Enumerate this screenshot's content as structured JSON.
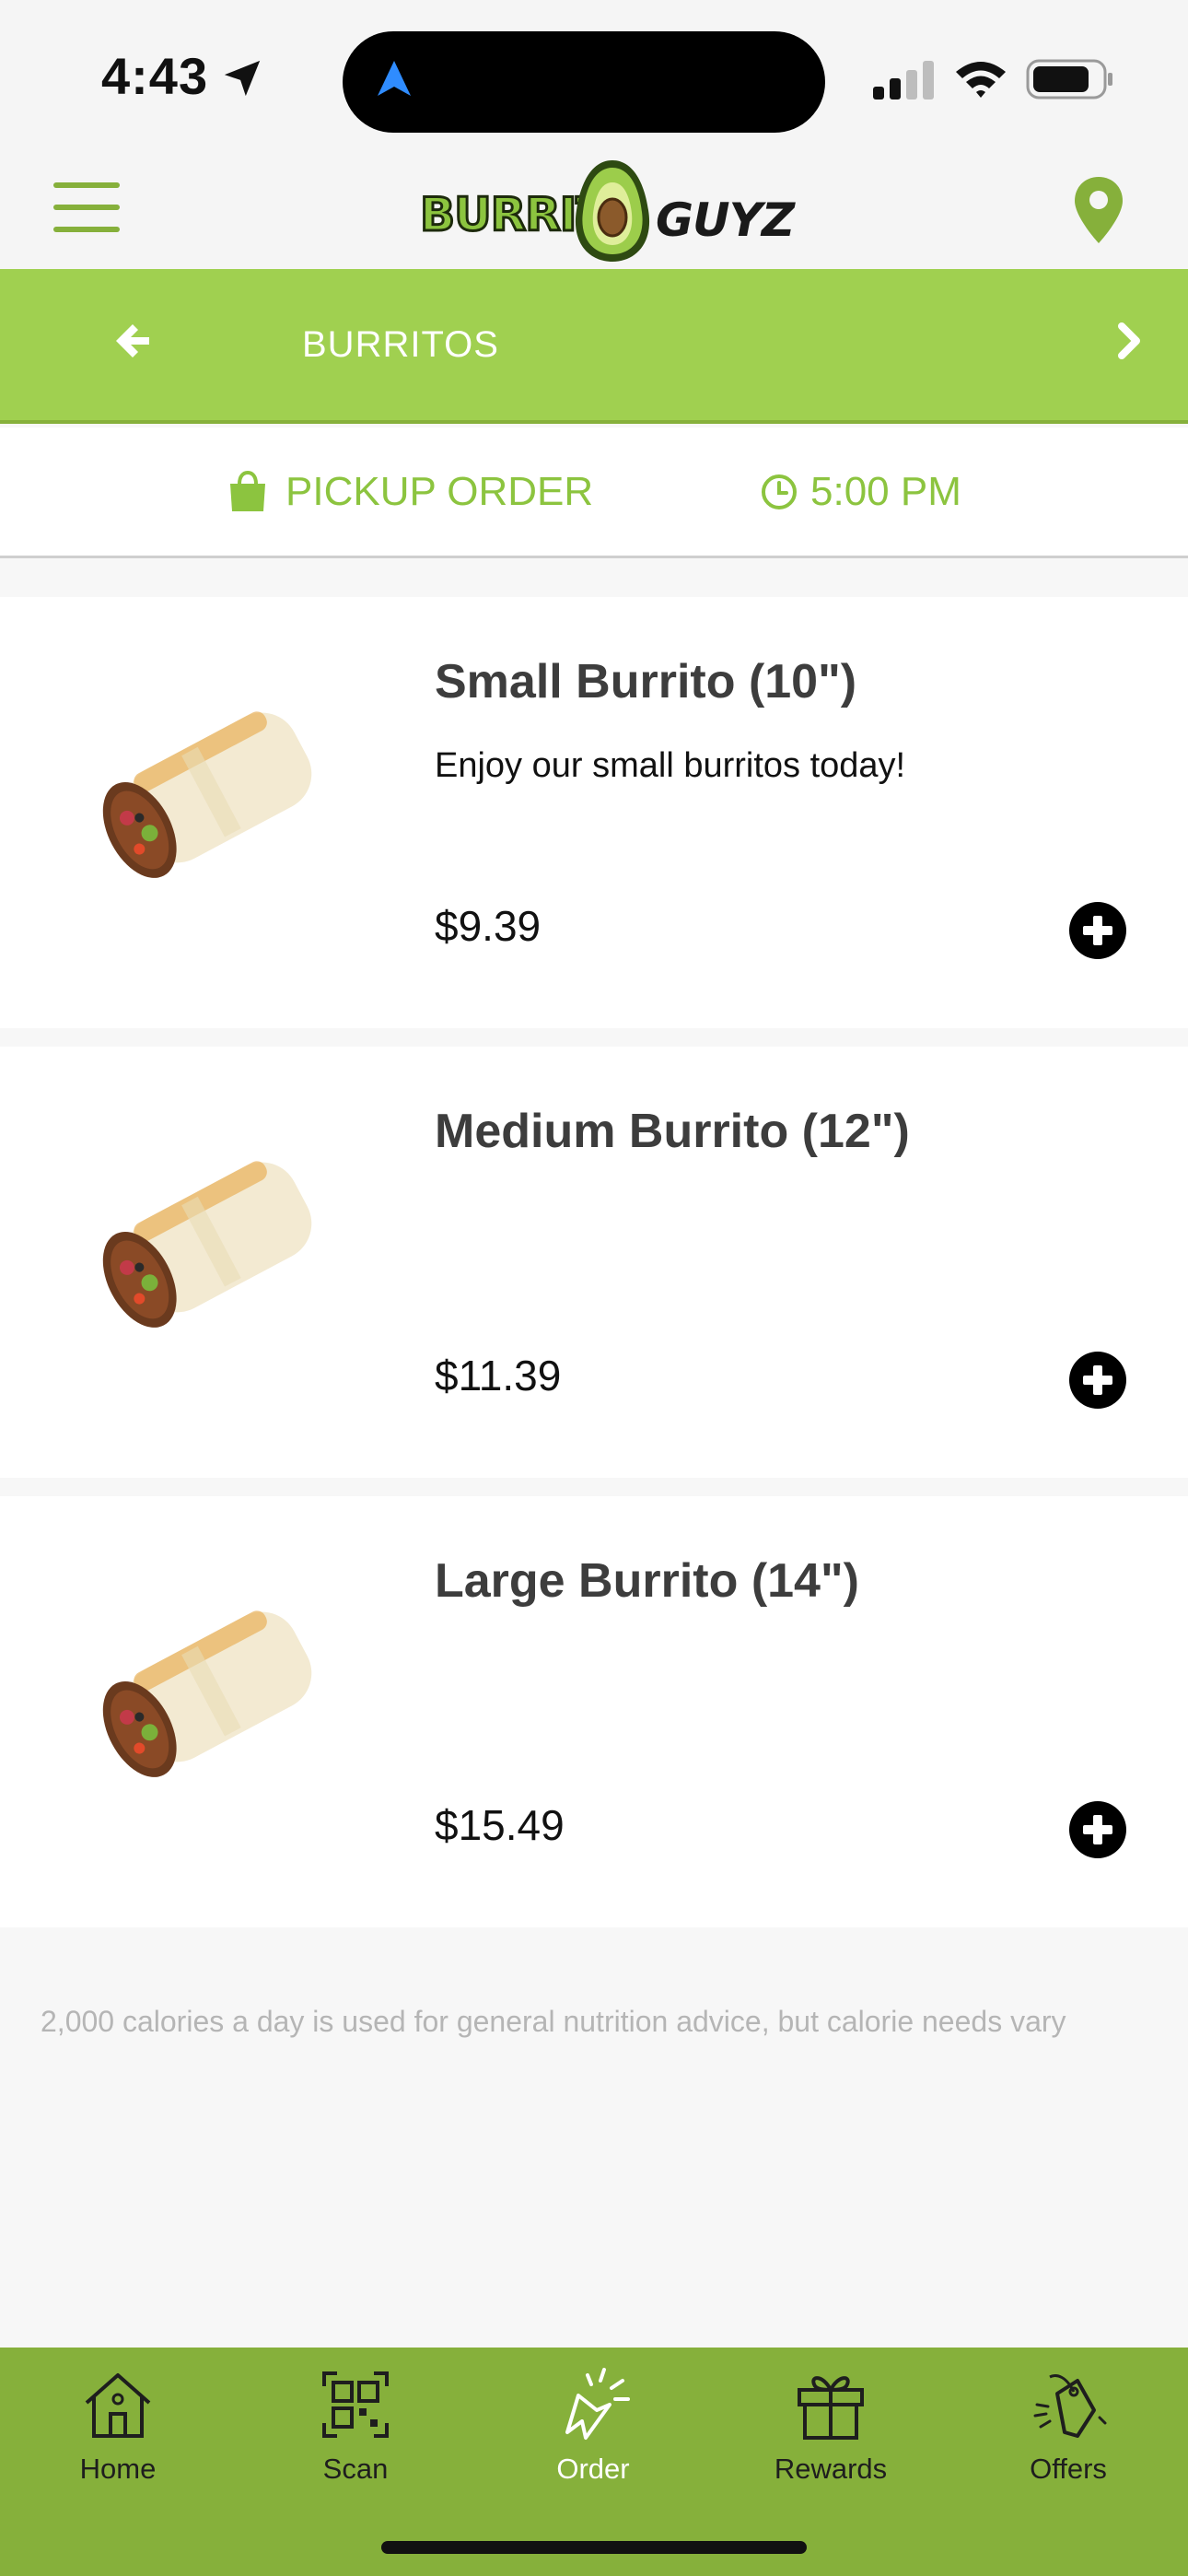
{
  "status_bar": {
    "time": "4:43",
    "icons": [
      "location-arrow-icon",
      "navigation-icon",
      "signal-icon",
      "wifi-icon",
      "battery-icon"
    ]
  },
  "header": {
    "logo_text_1": "BURRITO",
    "logo_text_2": "GUYZ",
    "icons": [
      "menu-icon",
      "location-pin-icon"
    ]
  },
  "category_bar": {
    "title": "BURRITOS",
    "icons": [
      "arrow-left-icon",
      "chevron-right-icon"
    ]
  },
  "order_info": {
    "mode_label": "PICKUP ORDER",
    "time_label": "5:00 PM",
    "icons": [
      "shopping-bag-icon",
      "clock-icon"
    ]
  },
  "products": [
    {
      "name": "Small Burrito (10\")",
      "description": "Enjoy our small burritos today!",
      "price": "$9.39"
    },
    {
      "name": "Medium Burrito (12\")",
      "description": "",
      "price": "$11.39"
    },
    {
      "name": "Large Burrito (14\")",
      "description": "",
      "price": "$15.49"
    }
  ],
  "nutrition_note": "2,000 calories a day is used for general nutrition advice, but calorie needs vary",
  "tab_bar": {
    "active": "Order",
    "tabs": [
      {
        "label": "Home",
        "icon": "home-icon"
      },
      {
        "label": "Scan",
        "icon": "qr-code-icon"
      },
      {
        "label": "Order",
        "icon": "tap-cursor-icon"
      },
      {
        "label": "Rewards",
        "icon": "gift-icon"
      },
      {
        "label": "Offers",
        "icon": "price-tag-icon"
      }
    ]
  },
  "colors": {
    "brand_green": "#a0d050",
    "brand_green_dark": "#86b03b",
    "accent_text": "#8cc43f",
    "background": "#f7f7f7"
  }
}
